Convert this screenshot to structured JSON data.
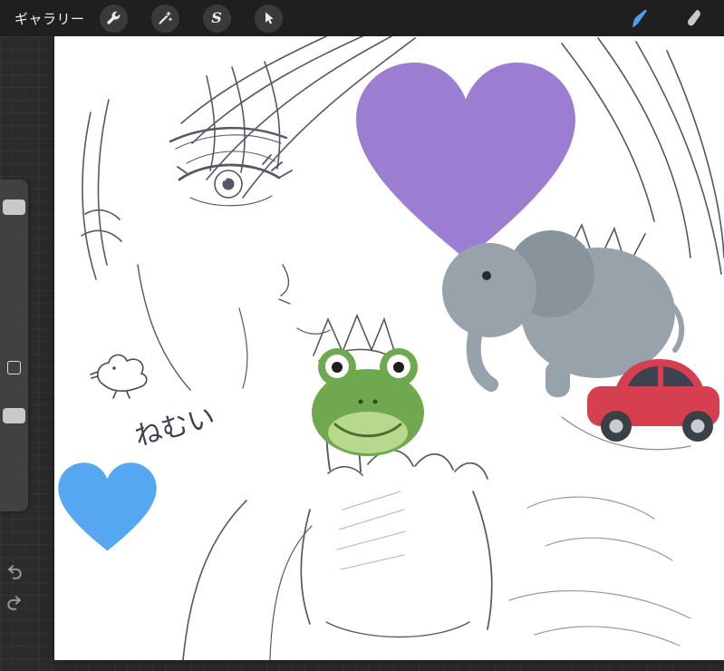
{
  "topbar": {
    "gallery_label": "ギャラリー",
    "selection_glyph": "S",
    "tools": {
      "actions": "Actions",
      "adjustments": "Adjustments",
      "selection": "Selection",
      "transform": "Transform",
      "paint": "Paint",
      "smudge": "Smudge"
    },
    "icons": [
      "wrench-icon",
      "magic-wand-icon",
      "selection-s-icon",
      "transform-cursor-icon",
      "brush-icon",
      "smudge-icon"
    ],
    "colors": {
      "bar": "#1f1f1f",
      "button": "#3a3a3a",
      "icon": "#ececec",
      "active_tool": "#4f9cf7"
    }
  },
  "sidebar": {
    "sliders": [
      {
        "name": "brush-size"
      },
      {
        "name": "opacity"
      }
    ],
    "has_modify_button": true,
    "icons": [
      "undo-icon",
      "redo-icon"
    ],
    "colors": {
      "bar": "#414141",
      "handle": "#c9c9c9",
      "arrow": "#9a9a9a"
    }
  },
  "workspace": {
    "background": "#2b2b2b",
    "canvas_background": "#ffffff"
  },
  "canvas": {
    "handwriting_text": "ねむい",
    "sketch_description": "pencil sketch of a face with large eye, bangs and a pointing hand",
    "sketch_stroke_color": "#3d4152",
    "stickers": [
      {
        "name": "purple-heart",
        "color": "#9b7ed2"
      },
      {
        "name": "elephant",
        "color": "#97a2ab"
      },
      {
        "name": "frog",
        "color": "#6fa84e"
      },
      {
        "name": "red-car",
        "color": "#d63f4f"
      },
      {
        "name": "blue-heart",
        "color": "#56a7f1"
      },
      {
        "name": "duck-doodle",
        "color": "#454a56"
      }
    ]
  }
}
